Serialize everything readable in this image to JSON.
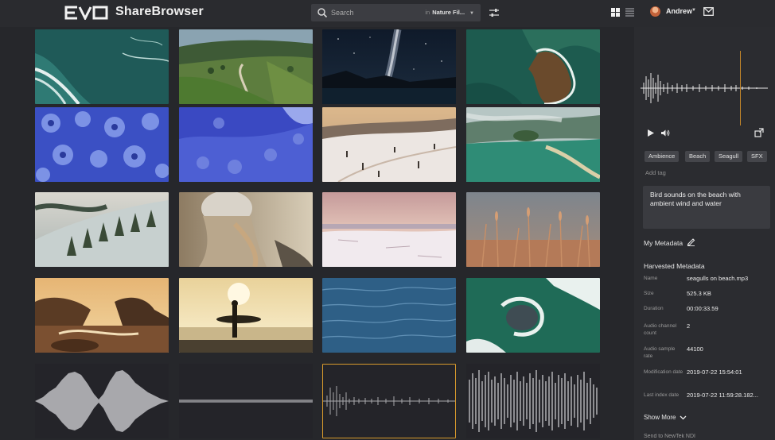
{
  "app": {
    "brand": "EVO",
    "title": "ShareBrowser"
  },
  "search": {
    "placeholder": "Search",
    "scope_prefix": "in",
    "scope_value": "Nature Fil..."
  },
  "user": {
    "name": "Andrew"
  },
  "colors": {
    "accent": "#d89a2c",
    "background": "#26272b",
    "panel": "#2b2c30"
  },
  "grid": {
    "rows": [
      [
        "aerial ocean waves",
        "green valley road",
        "milky way night sky",
        "rocky coast aerial"
      ],
      [
        "blue snowy forest",
        "blue snowy forest aerial",
        "snowy hills sunset",
        "misty green coast"
      ],
      [
        "foggy hillside trees",
        "woman in beanie",
        "snowy field dusk",
        "wheat grass field"
      ],
      [
        "rocky shore sunset",
        "surfer silhouette",
        "calm ocean water",
        "waves on rock aerial"
      ],
      [
        "audio waveform",
        "audio waveform",
        "audio waveform selected",
        "audio waveform"
      ]
    ]
  },
  "preview": {
    "play_icon": "play-icon",
    "volume_icon": "volume-icon",
    "expand_icon": "expand-icon",
    "playhead_fraction": 0.78
  },
  "tags": [
    "Ambience",
    "Beach",
    "Seagull",
    "SFX"
  ],
  "add_tag_label": "Add tag",
  "description": "Bird sounds on the beach with ambient wind and water",
  "my_metadata_label": "My Metadata",
  "harvested_title": "Harvested Metadata",
  "metadata": [
    {
      "key": "Name",
      "value": "seagulls on beach.mp3"
    },
    {
      "key": "Size",
      "value": "525.3 KB"
    },
    {
      "key": "Duration",
      "value": "00:00:33.59"
    },
    {
      "key": "Audio channel count",
      "value": "2"
    },
    {
      "key": "Audio sample rate",
      "value": "44100"
    },
    {
      "key": "Modification date",
      "value": "2019-07-22 15:54:01"
    },
    {
      "key": "Last index date",
      "value": "2019-07-22 11:59:28.182..."
    }
  ],
  "show_more_label": "Show More",
  "cutoff_text": "Send to NewTek NDI"
}
